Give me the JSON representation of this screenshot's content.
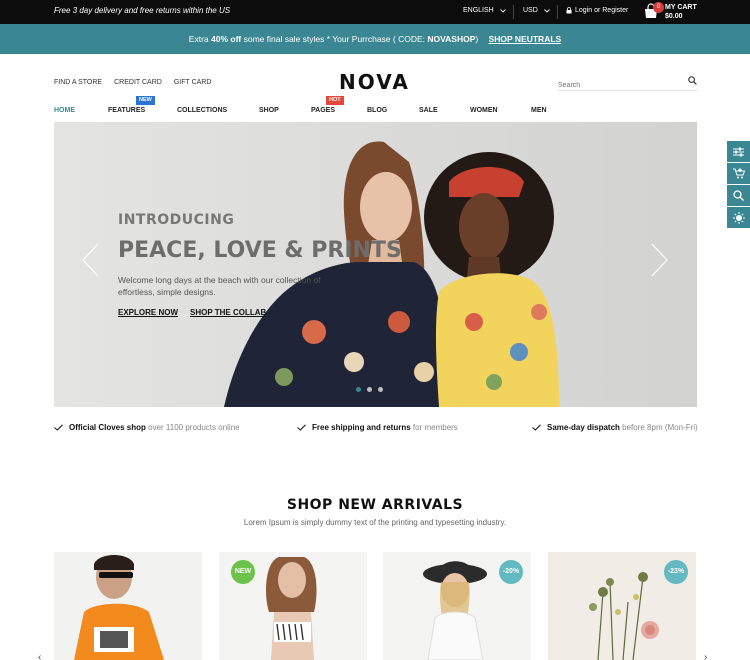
{
  "topbar": {
    "promo": "Free 3 day delivery and free returns within the US",
    "language": "ENGLISH",
    "currency": "USD",
    "login": "Login or Register",
    "cart_label": "MY CART",
    "cart_total": "$0.00",
    "cart_count": "0"
  },
  "announcement": {
    "prefix": "Extra ",
    "percent": "40% off",
    "middle": " some final sale styles * Your Purrchase ( CODE: ",
    "code": "NOVASHOP",
    "suffix": ")",
    "link": "SHOP NEUTRALS"
  },
  "header": {
    "util_links": [
      "FIND A STORE",
      "CREDIT CARD",
      "GIFT CARD"
    ],
    "logo": "NOVA",
    "search_placeholder": "Search"
  },
  "nav": {
    "items": [
      {
        "label": "HOME",
        "active": true
      },
      {
        "label": "FEATURES",
        "tag": "NEW"
      },
      {
        "label": "COLLECTIONS"
      },
      {
        "label": "SHOP"
      },
      {
        "label": "PAGES",
        "tag": "HOT"
      },
      {
        "label": "BLOG"
      },
      {
        "label": "SALE"
      },
      {
        "label": "WOMEN"
      },
      {
        "label": "MEN"
      }
    ]
  },
  "hero": {
    "intro": "INTRODUCING",
    "headline": "PEACE, LOVE & PRINTS",
    "description": "Welcome long days at the beach with our collection of effortless, simple designs.",
    "cta_primary": "EXPLORE NOW",
    "cta_secondary": "SHOP THE COLLAB",
    "slides": 3,
    "active_slide": 1
  },
  "features": [
    {
      "bold": "Official Cloves shop",
      "muted": " over 1100 products online"
    },
    {
      "bold": "Free shipping and returns",
      "muted": " for members"
    },
    {
      "bold": "Same-day dispatch",
      "muted": " before 8pm (Mon-Fri)"
    }
  ],
  "arrivals": {
    "title": "SHOP NEW ARRIVALS",
    "subtitle": "Lorem Ipsum is simply dummy text of the printing and typesetting industry.",
    "products": [
      {
        "badge": ""
      },
      {
        "badge": "NEW"
      },
      {
        "badge": "-20%"
      },
      {
        "badge": "-23%"
      }
    ]
  },
  "colors": {
    "accent": "#3a8793",
    "topbar": "#0c0c0c",
    "new_tag": "#2a76d2",
    "hot_tag": "#e2483b",
    "new_badge": "#6cc24a",
    "sale_badge": "#62b9c0"
  },
  "icons": {
    "side_tools": [
      "sliders-icon",
      "cart-plus-icon",
      "search-icon",
      "sun-icon"
    ]
  }
}
